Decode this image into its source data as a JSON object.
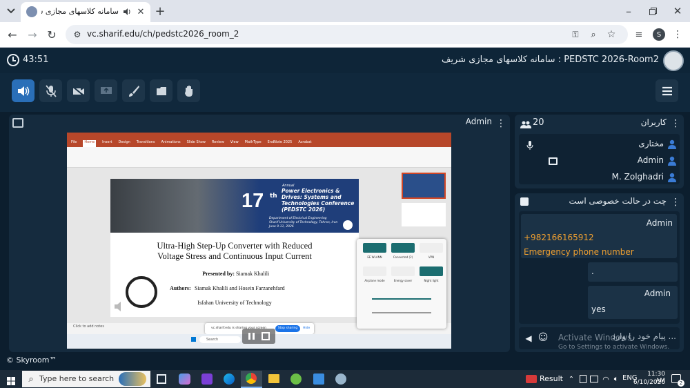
{
  "browser": {
    "tab_title": "سامانه کلاسهای مجازی شریف -",
    "url": "vc.sharif.edu/ch/pedstc2026_room_2",
    "profile_initial": "S"
  },
  "app": {
    "timer": "43:51",
    "room_title": "سامانه کلاسهای مجازی شریف : PEDSTC 2026-Room2",
    "footer": "© Skyroom™"
  },
  "video_panel": {
    "presenter": "Admin"
  },
  "users_panel": {
    "title": "کاربران",
    "count": "20",
    "users": [
      {
        "name": "مختاری"
      },
      {
        "name": "Admin"
      },
      {
        "name": "M. Zolghadri"
      }
    ]
  },
  "chat_panel": {
    "title": "چت در حالت خصوصی است",
    "messages": [
      {
        "sender": "Admin",
        "text": ""
      },
      {
        "sender": "",
        "text": "."
      },
      {
        "sender": "Admin",
        "text": "yes"
      }
    ],
    "highlight_phone": "+982166165912",
    "highlight_label": "Emergency phone number",
    "input_placeholder": "پیام خود را وارد ...",
    "watermark_title": "Activate Windows",
    "watermark_sub": "Go to Settings to activate Windows."
  },
  "slide": {
    "badge_number": "17",
    "badge_sup": "th",
    "badge_annual": "Annual",
    "conf_name": "Power Electronics & Drives: Systems and Technologies Conference (PEDSTC 2026)",
    "dept": "Department of Electrical Engineering",
    "uni_line": "Sharif University of Technology, Tehran, Iran",
    "dates": "June 9-11, 2026",
    "title_line1": "Ultra-High Step-Up Converter with Reduced",
    "title_line2": "Voltage Stress and Continuous Input Current",
    "presented_label": "Presented by:",
    "presented_name": "Siamak Khalili",
    "authors_label": "Authors:",
    "authors_names": "Siamak Khalili and Hosein Farzanehfard",
    "affiliation": "Isfahan University of Technology",
    "notes": "Click to add notes",
    "ppt_tabs": [
      "File",
      "Home",
      "Insert",
      "Design",
      "Transitions",
      "Animations",
      "Slide Show",
      "Review",
      "View",
      "MathType",
      "EndNote 2025",
      "Acrobat"
    ],
    "sharing_text": "vc.sharif.edu is sharing your screen",
    "stop_sharing": "Stop sharing",
    "hide": "Hide",
    "search": "Search",
    "qs_labels": [
      "EE WLANN",
      "Connected (2)",
      "VPN",
      "Airplane mode",
      "Energy saver",
      "Night light"
    ]
  },
  "taskbar": {
    "search_placeholder": "Type here to search",
    "result_label": "Result",
    "lang": "ENG",
    "time": "11:30 AM",
    "date": "6/10/2026",
    "notif_count": "2"
  },
  "colors": {
    "accent_blue": "#3a7bd5",
    "phone_orange": "#f0a030",
    "slide_navy": "#1f3e7a"
  }
}
